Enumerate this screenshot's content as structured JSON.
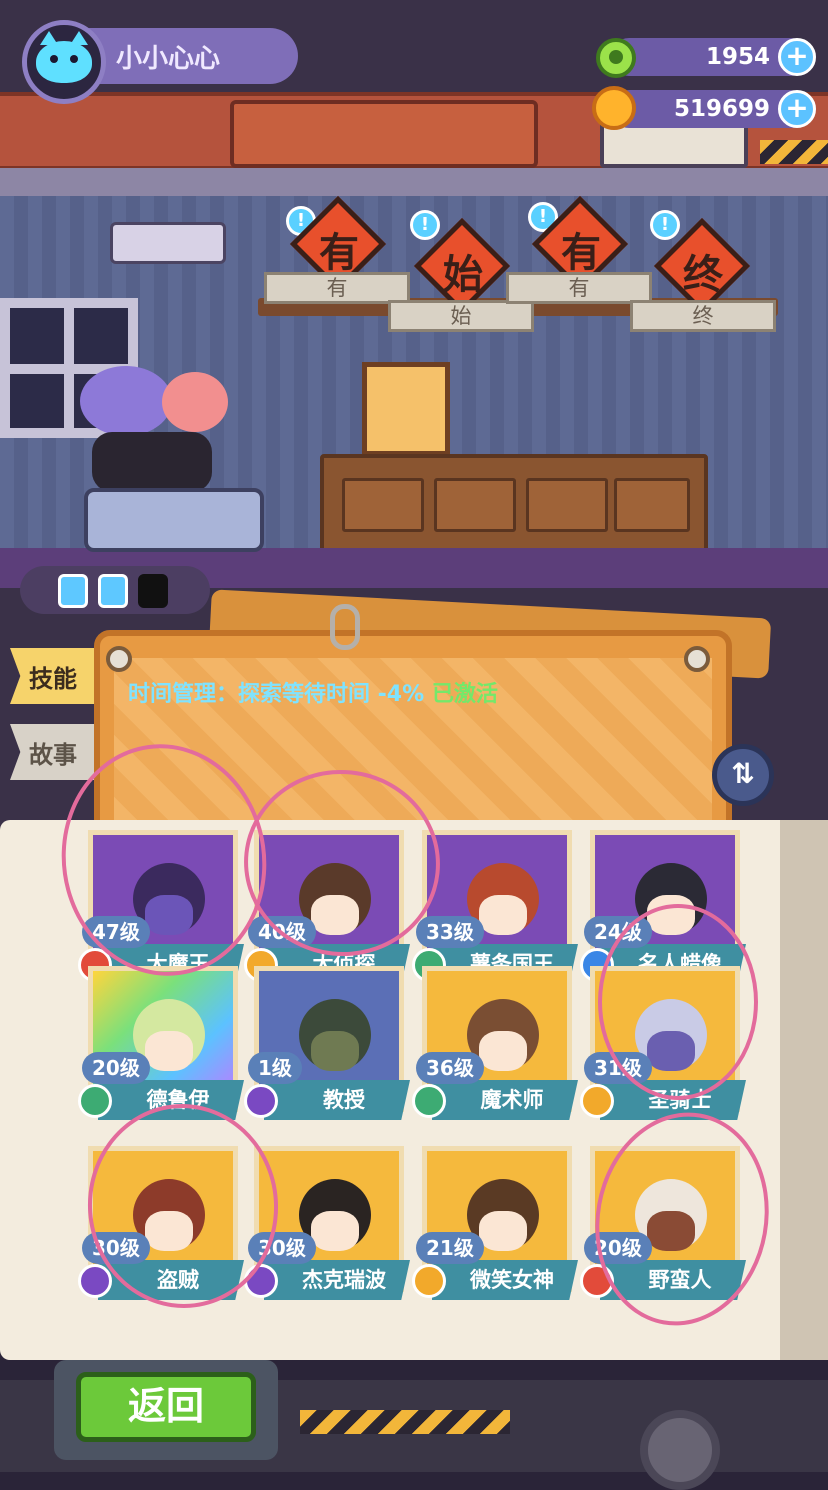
{
  "player": {
    "name": "小小心心"
  },
  "currency": {
    "gems": "1954",
    "coins": "519699",
    "plus_label": "+"
  },
  "signs": [
    {
      "char": "有",
      "plate": "有"
    },
    {
      "char": "始",
      "plate": "始"
    },
    {
      "char": "有",
      "plate": "有"
    },
    {
      "char": "终",
      "plate": "终"
    }
  ],
  "bubble_label": "!",
  "tabs": {
    "skill": "技能",
    "story": "故事"
  },
  "skill": {
    "text": "时间管理：探索等待时间 -4%",
    "status": "已激活"
  },
  "swap_label": "⇅",
  "heroes": [
    {
      "level": "47级",
      "name": "大魔王",
      "badge": "red"
    },
    {
      "level": "40级",
      "name": "大侦探",
      "badge": "gold"
    },
    {
      "level": "33级",
      "name": "薯条国王",
      "badge": "green"
    },
    {
      "level": "24级",
      "name": "名人蜡像",
      "badge": "blue"
    },
    {
      "level": "20级",
      "name": "德鲁伊",
      "badge": "green"
    },
    {
      "level": "1级",
      "name": "教授",
      "badge": "purple"
    },
    {
      "level": "36级",
      "name": "魔术师",
      "badge": "green"
    },
    {
      "level": "31级",
      "name": "圣骑士",
      "badge": "gold"
    },
    {
      "level": "30级",
      "name": "盗贼",
      "badge": "purple"
    },
    {
      "level": "30级",
      "name": "杰克瑞波",
      "badge": "purple"
    },
    {
      "level": "21级",
      "name": "微笑女神",
      "badge": "gold"
    },
    {
      "level": "20级",
      "name": "野蛮人",
      "badge": "red"
    }
  ],
  "back_button": "返回",
  "colors": {
    "accent_pink_marker": "#e36b9c",
    "skill_text": "#7fe3ff",
    "status_active": "#74e86a"
  }
}
